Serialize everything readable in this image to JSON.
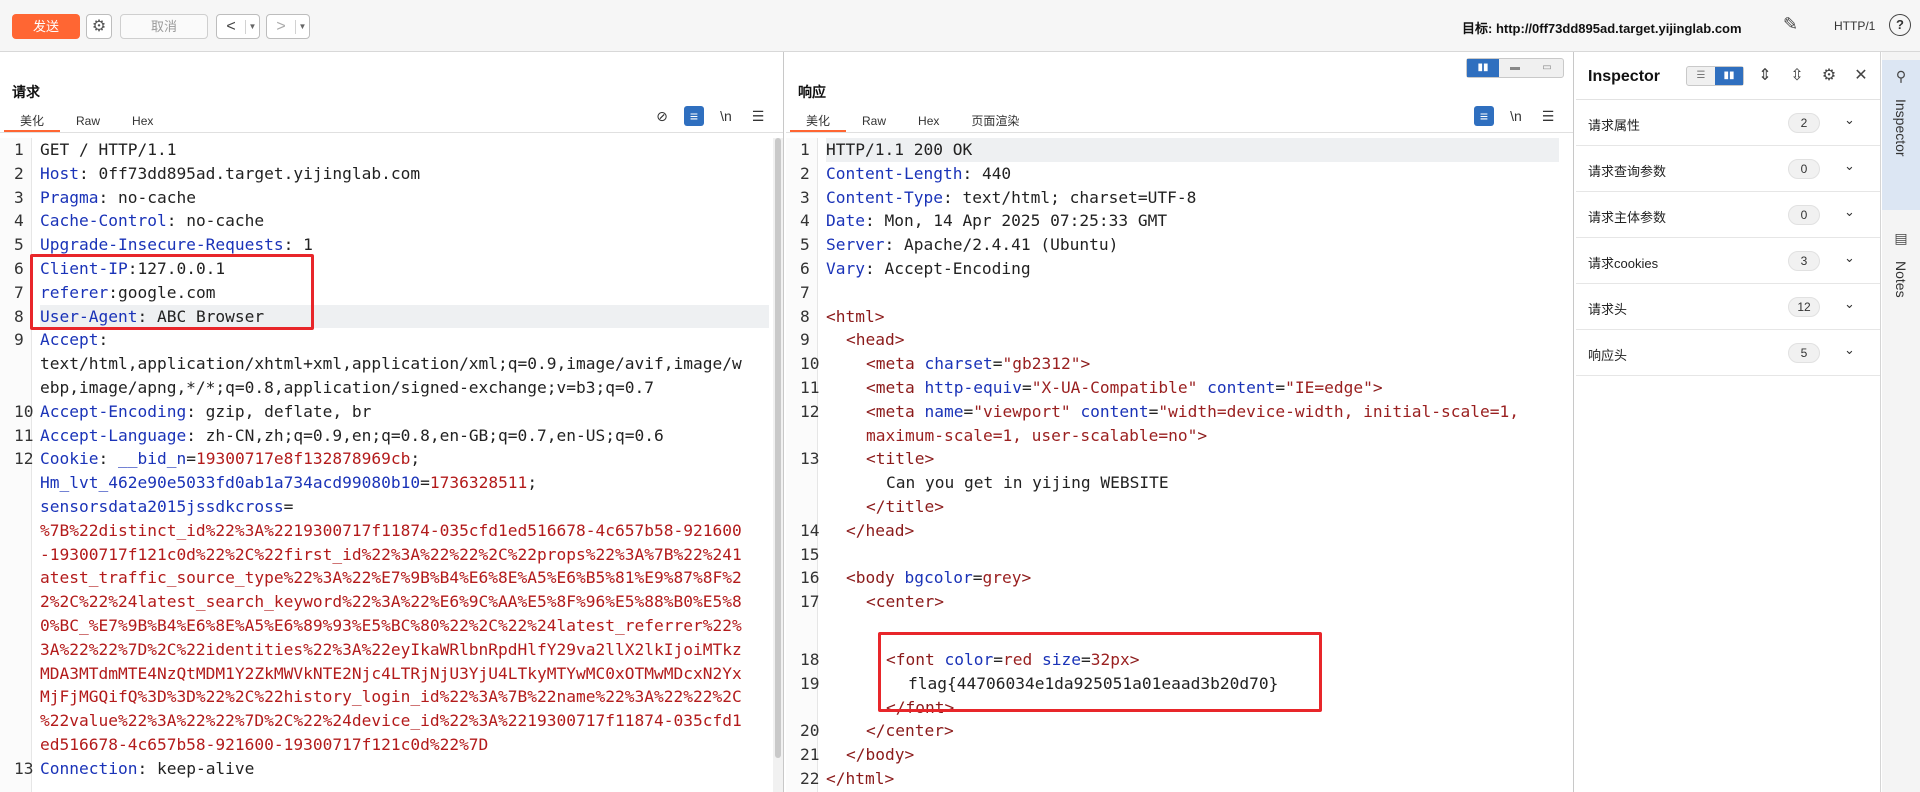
{
  "toolbar": {
    "send_label": "发送",
    "cancel_label": "取消",
    "back_arrow": "<",
    "forward_arrow": ">",
    "dropdown_caret": "▼",
    "target_label": "目标: ",
    "target_url": "http://0ff73dd895ad.target.yijinglab.com",
    "http_version": "HTTP/1",
    "help": "?"
  },
  "request": {
    "title": "请求",
    "tabs": [
      "美化",
      "Raw",
      "Hex"
    ],
    "lines": [
      {
        "n": "1",
        "parts": [
          [
            "v",
            "GET / HTTP/1.1"
          ]
        ]
      },
      {
        "n": "2",
        "parts": [
          [
            "k",
            "Host"
          ],
          [
            "v",
            ": 0ff73dd895ad.target.yijinglab.com"
          ]
        ]
      },
      {
        "n": "3",
        "parts": [
          [
            "k",
            "Pragma"
          ],
          [
            "v",
            ": no-cache"
          ]
        ]
      },
      {
        "n": "4",
        "parts": [
          [
            "k",
            "Cache-Control"
          ],
          [
            "v",
            ": no-cache"
          ]
        ]
      },
      {
        "n": "5",
        "parts": [
          [
            "k",
            "Upgrade-Insecure-Requests"
          ],
          [
            "v",
            ": 1"
          ]
        ]
      },
      {
        "n": "6",
        "parts": [
          [
            "k",
            "Client-IP"
          ],
          [
            "v",
            ":127.0.0.1"
          ]
        ]
      },
      {
        "n": "7",
        "parts": [
          [
            "k",
            "referer"
          ],
          [
            "v",
            ":google.com"
          ]
        ]
      },
      {
        "n": "8",
        "parts": [
          [
            "k",
            "User-Agent"
          ],
          [
            "v",
            ": ABC Browser"
          ]
        ],
        "hl": true
      },
      {
        "n": "9",
        "parts": [
          [
            "k",
            "Accept"
          ],
          [
            "v",
            ":"
          ]
        ]
      },
      {
        "n": "",
        "parts": [
          [
            "v",
            "text/html,application/xhtml+xml,application/xml;q=0.9,image/avif,image/w"
          ]
        ]
      },
      {
        "n": "",
        "parts": [
          [
            "v",
            "ebp,image/apng,*/*;q=0.8,application/signed-exchange;v=b3;q=0.7"
          ]
        ]
      },
      {
        "n": "10",
        "parts": [
          [
            "k",
            "Accept-Encoding"
          ],
          [
            "v",
            ": gzip, deflate, br"
          ]
        ]
      },
      {
        "n": "11",
        "parts": [
          [
            "k",
            "Accept-Language"
          ],
          [
            "v",
            ": zh-CN,zh;q=0.9,en;q=0.8,en-GB;q=0.7,en-US;q=0.6"
          ]
        ]
      },
      {
        "n": "12",
        "parts": [
          [
            "k",
            "Cookie"
          ],
          [
            "v",
            ": "
          ],
          [
            "k",
            "__bid_n"
          ],
          [
            "v",
            "="
          ],
          [
            "r",
            "19300717e8f132878969cb"
          ],
          [
            "v",
            ";"
          ]
        ]
      },
      {
        "n": "",
        "parts": [
          [
            "k",
            "Hm_lvt_462e90e5033fd0ab1a734acd99080b10"
          ],
          [
            "v",
            "="
          ],
          [
            "r",
            "1736328511"
          ],
          [
            "v",
            ";"
          ]
        ]
      },
      {
        "n": "",
        "parts": [
          [
            "k",
            "sensorsdata2015jssdkcross"
          ],
          [
            "v",
            "="
          ]
        ]
      },
      {
        "n": "",
        "parts": [
          [
            "r",
            "%7B%22distinct_id%22%3A%2219300717f11874-035cfd1ed516678-4c657b58-921600"
          ]
        ]
      },
      {
        "n": "",
        "parts": [
          [
            "r",
            "-19300717f121c0d%22%2C%22first_id%22%3A%22%22%2C%22props%22%3A%7B%22%241"
          ]
        ]
      },
      {
        "n": "",
        "parts": [
          [
            "r",
            "atest_traffic_source_type%22%3A%22%E7%9B%B4%E6%8E%A5%E6%B5%81%E9%87%8F%2"
          ]
        ]
      },
      {
        "n": "",
        "parts": [
          [
            "r",
            "2%2C%22%24latest_search_keyword%22%3A%22%E6%9C%AA%E5%8F%96%E5%88%B0%E5%8"
          ]
        ]
      },
      {
        "n": "",
        "parts": [
          [
            "r",
            "0%BC_%E7%9B%B4%E6%8E%A5%E6%89%93%E5%BC%80%22%2C%22%24latest_referrer%22%"
          ]
        ]
      },
      {
        "n": "",
        "parts": [
          [
            "r",
            "3A%22%22%7D%2C%22identities%22%3A%22eyIkaWRlbnRpdHlfY29va2llX2lkIjoiMTkz"
          ]
        ]
      },
      {
        "n": "",
        "parts": [
          [
            "r",
            "MDA3MTdmMTE4NzQtMDM1Y2ZkMWVkNTE2Njc4LTRjNjU3YjU4LTkyMTYwMC0xOTMwMDcxN2Yx"
          ]
        ]
      },
      {
        "n": "",
        "parts": [
          [
            "r",
            "MjFjMGQifQ%3D%3D%22%2C%22history_login_id%22%3A%7B%22name%22%3A%22%22%2C"
          ]
        ]
      },
      {
        "n": "",
        "parts": [
          [
            "r",
            "%22value%22%3A%22%22%7D%2C%22%24device_id%22%3A%2219300717f11874-035cfd1"
          ]
        ]
      },
      {
        "n": "",
        "parts": [
          [
            "r",
            "ed516678-4c657b58-921600-19300717f121c0d%22%7D"
          ]
        ]
      },
      {
        "n": "13",
        "parts": [
          [
            "k",
            "Connection"
          ],
          [
            "v",
            ": keep-alive"
          ]
        ]
      }
    ]
  },
  "response": {
    "title": "响应",
    "tabs": [
      "美化",
      "Raw",
      "Hex",
      "页面渲染"
    ],
    "lines": [
      {
        "n": "1",
        "ind": 0,
        "parts": [
          [
            "v",
            "HTTP/1.1 200 OK"
          ]
        ],
        "hl": true
      },
      {
        "n": "2",
        "ind": 0,
        "parts": [
          [
            "k",
            "Content-Length"
          ],
          [
            "v",
            ": 440"
          ]
        ]
      },
      {
        "n": "3",
        "ind": 0,
        "parts": [
          [
            "k",
            "Content-Type"
          ],
          [
            "v",
            ": text/html; charset=UTF-8"
          ]
        ]
      },
      {
        "n": "4",
        "ind": 0,
        "parts": [
          [
            "k",
            "Date"
          ],
          [
            "v",
            ": Mon, 14 Apr 2025 07:25:33 GMT"
          ]
        ]
      },
      {
        "n": "5",
        "ind": 0,
        "parts": [
          [
            "k",
            "Server"
          ],
          [
            "v",
            ": Apache/2.4.41 (Ubuntu)"
          ]
        ]
      },
      {
        "n": "6",
        "ind": 0,
        "parts": [
          [
            "k",
            "Vary"
          ],
          [
            "v",
            ": Accept-Encoding"
          ]
        ]
      },
      {
        "n": "7",
        "ind": 0,
        "parts": [
          [
            "v",
            " "
          ]
        ]
      },
      {
        "n": "8",
        "ind": 0,
        "parts": [
          [
            "tag",
            "<html>"
          ]
        ]
      },
      {
        "n": "9",
        "ind": 1,
        "parts": [
          [
            "tag",
            "<head>"
          ]
        ]
      },
      {
        "n": "10",
        "ind": 2,
        "parts": [
          [
            "tag",
            "<meta "
          ],
          [
            "attr",
            "charset"
          ],
          [
            "v",
            "="
          ],
          [
            "t",
            "\"gb2312\""
          ],
          [
            "tag",
            ">"
          ]
        ]
      },
      {
        "n": "11",
        "ind": 2,
        "parts": [
          [
            "tag",
            "<meta "
          ],
          [
            "attr",
            "http-equiv"
          ],
          [
            "v",
            "="
          ],
          [
            "t",
            "\"X-UA-Compatible\""
          ],
          [
            "v",
            " "
          ],
          [
            "attr",
            "content"
          ],
          [
            "v",
            "="
          ],
          [
            "t",
            "\"IE=edge\""
          ],
          [
            "tag",
            ">"
          ]
        ]
      },
      {
        "n": "12",
        "ind": 2,
        "parts": [
          [
            "tag",
            "<meta "
          ],
          [
            "attr",
            "name"
          ],
          [
            "v",
            "="
          ],
          [
            "t",
            "\"viewport\""
          ],
          [
            "v",
            " "
          ],
          [
            "attr",
            "content"
          ],
          [
            "v",
            "="
          ],
          [
            "t",
            "\"width=device-width, initial-scale=1,"
          ]
        ]
      },
      {
        "n": "",
        "ind": 2,
        "parts": [
          [
            "t",
            "maximum-scale=1, user-scalable=no\""
          ],
          [
            "tag",
            ">"
          ]
        ]
      },
      {
        "n": "13",
        "ind": 2,
        "parts": [
          [
            "tag",
            "<title>"
          ]
        ]
      },
      {
        "n": "",
        "ind": 3,
        "parts": [
          [
            "v",
            "Can you get in yijing WEBSITE"
          ]
        ]
      },
      {
        "n": "",
        "ind": 2,
        "parts": [
          [
            "tag",
            "</title>"
          ]
        ]
      },
      {
        "n": "14",
        "ind": 1,
        "parts": [
          [
            "tag",
            "</head>"
          ]
        ]
      },
      {
        "n": "15",
        "ind": 0,
        "parts": [
          [
            "v",
            " "
          ]
        ]
      },
      {
        "n": "16",
        "ind": 1,
        "parts": [
          [
            "tag",
            "<body "
          ],
          [
            "attr",
            "bgcolor"
          ],
          [
            "v",
            "="
          ],
          [
            "t",
            "grey"
          ],
          [
            "tag",
            ">"
          ]
        ]
      },
      {
        "n": "17",
        "ind": 2,
        "parts": [
          [
            "tag",
            "<center>"
          ]
        ]
      },
      {
        "n": "",
        "ind": 0,
        "parts": [
          [
            "v",
            " "
          ]
        ],
        "gap": true
      },
      {
        "n": "18",
        "ind": 3,
        "parts": [
          [
            "tag",
            "<font "
          ],
          [
            "attr",
            "color"
          ],
          [
            "v",
            "="
          ],
          [
            "t",
            "red"
          ],
          [
            "v",
            " "
          ],
          [
            "attr",
            "size"
          ],
          [
            "v",
            "="
          ],
          [
            "t",
            "32px"
          ],
          [
            "tag",
            ">"
          ]
        ]
      },
      {
        "n": "19",
        "ind": 4,
        "parts": [
          [
            "v",
            "flag{44706034e1da925051a01eaad3b20d70}"
          ]
        ]
      },
      {
        "n": "",
        "ind": 3,
        "parts": [
          [
            "tag",
            "</font>"
          ]
        ]
      },
      {
        "n": "20",
        "ind": 2,
        "parts": [
          [
            "tag",
            "</center>"
          ]
        ]
      },
      {
        "n": "21",
        "ind": 1,
        "parts": [
          [
            "tag",
            "</body>"
          ]
        ]
      },
      {
        "n": "22",
        "ind": 0,
        "parts": [
          [
            "tag",
            "</html>"
          ]
        ]
      }
    ]
  },
  "inspector": {
    "title": "Inspector",
    "rows": [
      {
        "label": "请求属性",
        "count": "2"
      },
      {
        "label": "请求查询参数",
        "count": "0"
      },
      {
        "label": "请求主体参数",
        "count": "0"
      },
      {
        "label": "请求cookies",
        "count": "3"
      },
      {
        "label": "请求头",
        "count": "12"
      },
      {
        "label": "响应头",
        "count": "5"
      }
    ]
  },
  "side_tabs": {
    "inspector": "Inspector",
    "notes": "Notes"
  },
  "colors": {
    "accent": "#ff6633",
    "header_key": "#1a33b8",
    "value_red": "#b31b1b",
    "highlight_box": "#e8262a",
    "toggle_blue": "#2f6fbf"
  }
}
